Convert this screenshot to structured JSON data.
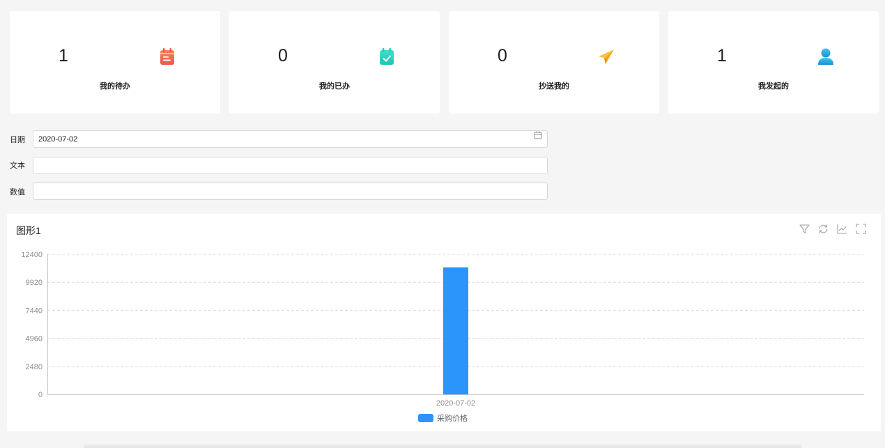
{
  "stats": [
    {
      "value": "1",
      "label": "我的待办",
      "icon": "calendar-icon",
      "color": "#f0705a"
    },
    {
      "value": "0",
      "label": "我的已办",
      "icon": "calendar-check-icon",
      "color": "#2dd4c0"
    },
    {
      "value": "0",
      "label": "抄送我的",
      "icon": "paper-plane-icon",
      "color": "#f5b82a"
    },
    {
      "value": "1",
      "label": "我发起的",
      "icon": "user-icon",
      "color": "#2aa8e0"
    }
  ],
  "form": {
    "date_label": "日期",
    "date_value": "2020-07-02",
    "text_label": "文本",
    "text_value": "",
    "number_label": "数值",
    "number_value": ""
  },
  "chart_panel": {
    "title": "图形1",
    "tools": [
      "filter-icon",
      "refresh-icon",
      "line-chart-icon",
      "fullscreen-icon"
    ]
  },
  "chart_data": {
    "type": "bar",
    "categories": [
      "2020-07-02"
    ],
    "series": [
      {
        "name": "采购价格",
        "values": [
          11250
        ],
        "color": "#2b95fb"
      }
    ],
    "y_ticks": [
      "0",
      "2480",
      "4960",
      "7440",
      "9920",
      "12400"
    ],
    "ylim": [
      0,
      12400
    ],
    "grid": true,
    "legend_position": "bottom-center"
  }
}
